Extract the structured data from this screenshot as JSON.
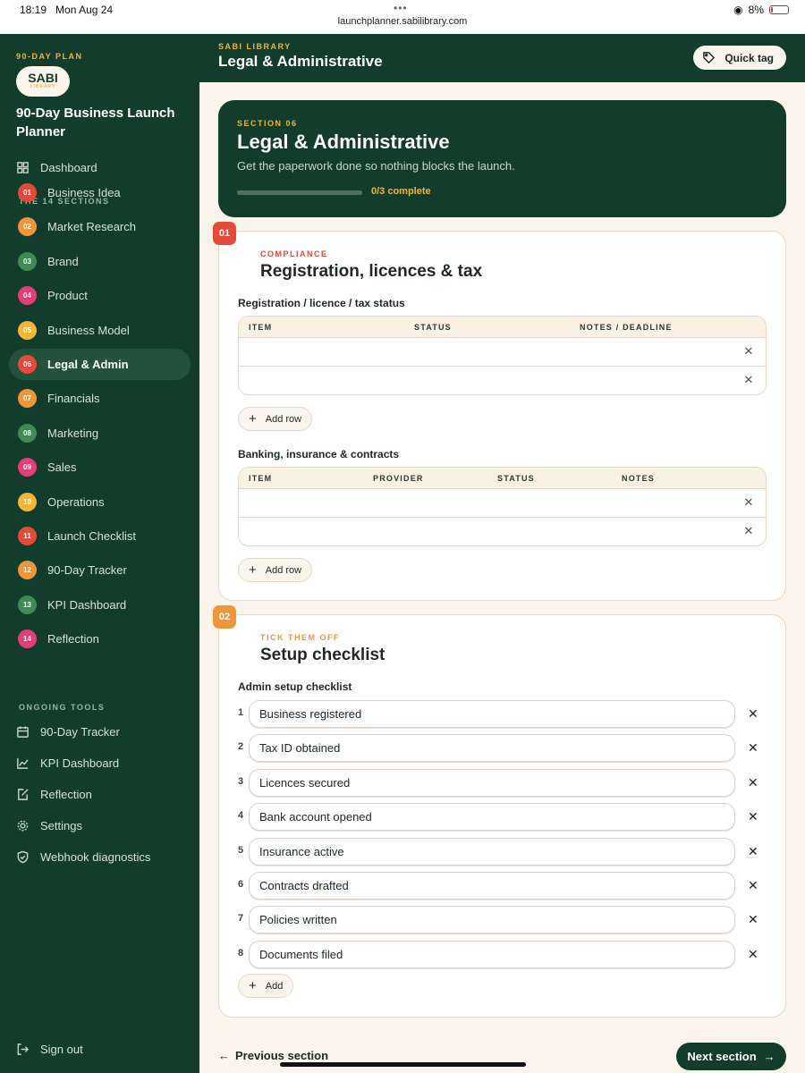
{
  "status": {
    "time": "18:19",
    "date": "Mon Aug 24",
    "url": "launchplanner.sabilibrary.com",
    "battery": "8%"
  },
  "sidebar": {
    "plan_label": "90-DAY PLAN",
    "logo_main": "SABI",
    "logo_sub": "LIBRARY",
    "app_title": "90-Day Business Launch Planner",
    "dashboard": "Dashboard",
    "sections_head": "THE 14 SECTIONS",
    "items": [
      {
        "num": "01",
        "label": "Business Idea",
        "color": "#e5493a"
      },
      {
        "num": "02",
        "label": "Market Research",
        "color": "#f0963a"
      },
      {
        "num": "03",
        "label": "Brand",
        "color": "#3f8a55"
      },
      {
        "num": "04",
        "label": "Product",
        "color": "#e0407a"
      },
      {
        "num": "05",
        "label": "Business Model",
        "color": "#f2b632"
      },
      {
        "num": "06",
        "label": "Legal & Admin",
        "color": "#e5493a"
      },
      {
        "num": "07",
        "label": "Financials",
        "color": "#f0963a"
      },
      {
        "num": "08",
        "label": "Marketing",
        "color": "#3f8a55"
      },
      {
        "num": "09",
        "label": "Sales",
        "color": "#e0407a"
      },
      {
        "num": "10",
        "label": "Operations",
        "color": "#f2b632"
      },
      {
        "num": "11",
        "label": "Launch Checklist",
        "color": "#e5493a"
      },
      {
        "num": "12",
        "label": "90-Day Tracker",
        "color": "#f0963a"
      },
      {
        "num": "13",
        "label": "KPI Dashboard",
        "color": "#3f8a55"
      },
      {
        "num": "14",
        "label": "Reflection",
        "color": "#e0407a"
      }
    ],
    "tools_head": "ONGOING TOOLS",
    "tools": [
      {
        "label": "90-Day Tracker",
        "icon": "calendar-icon"
      },
      {
        "label": "KPI Dashboard",
        "icon": "chart-icon"
      },
      {
        "label": "Reflection",
        "icon": "edit-icon"
      },
      {
        "label": "Settings",
        "icon": "gear-icon"
      },
      {
        "label": "Webhook diagnostics",
        "icon": "shield-icon"
      }
    ],
    "sign_out": "Sign out"
  },
  "header": {
    "label": "SABI LIBRARY",
    "title": "Legal & Administrative",
    "quick_tag": "Quick tag"
  },
  "hero": {
    "label": "SECTION 06",
    "title": "Legal & Administrative",
    "subtitle": "Get the paperwork done so nothing blocks the launch.",
    "progress_text": "0/3 complete",
    "progress_fraction": 0
  },
  "card1": {
    "num": "01",
    "kicker": "COMPLIANCE",
    "title": "Registration, licences & tax",
    "table1": {
      "title": "Registration / licence / tax status",
      "columns": [
        "ITEM",
        "STATUS",
        "NOTES / DEADLINE"
      ],
      "rows": 2,
      "add": "Add row"
    },
    "table2": {
      "title": "Banking, insurance & contracts",
      "columns": [
        "ITEM",
        "PROVIDER",
        "STATUS",
        "NOTES"
      ],
      "rows": 2,
      "add": "Add row"
    }
  },
  "card2": {
    "num": "02",
    "kicker": "TICK THEM OFF",
    "title": "Setup checklist",
    "list_title": "Admin setup checklist",
    "items": [
      "Business registered",
      "Tax ID obtained",
      "Licences secured",
      "Bank account opened",
      "Insurance active",
      "Contracts drafted",
      "Policies written",
      "Documents filed"
    ],
    "add": "Add"
  },
  "footer": {
    "prev": "Previous section",
    "next": "Next section"
  },
  "colors": {
    "brand": "#123c2c",
    "accent": "#f2b632",
    "danger": "#e5493a",
    "orange": "#f0963a"
  }
}
